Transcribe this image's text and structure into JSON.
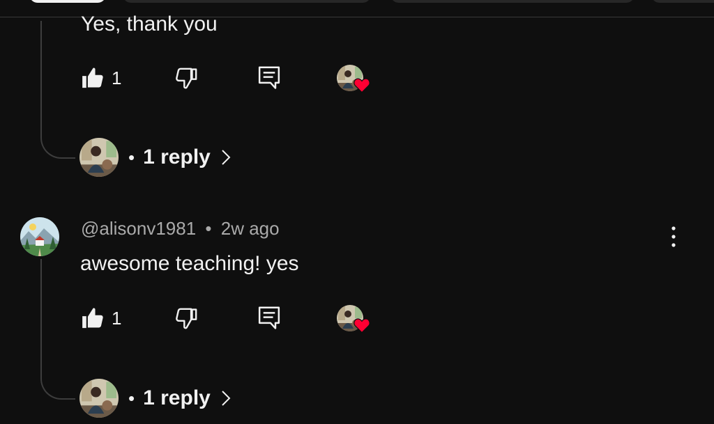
{
  "comments": [
    {
      "text": "Yes, thank you",
      "likes": "1",
      "replies_label": "1 reply"
    },
    {
      "author": "@alisonv1981",
      "separator": "•",
      "age": "2w ago",
      "text": "awesome teaching! yes",
      "likes": "1",
      "replies_label": "1 reply"
    }
  ],
  "reply_prefix": "•",
  "icons": {
    "like": "thumb-up-icon",
    "dislike": "thumb-down-icon",
    "reply": "comment-reply-icon",
    "creator_heart": "creator-heart-icon",
    "chevron": "chevron-right-icon",
    "menu": "more-vertical-icon"
  },
  "colors": {
    "background": "#0f0f0f",
    "text": "#f1f1f1",
    "meta": "#aaaaaa",
    "heart": "#ff0033"
  }
}
